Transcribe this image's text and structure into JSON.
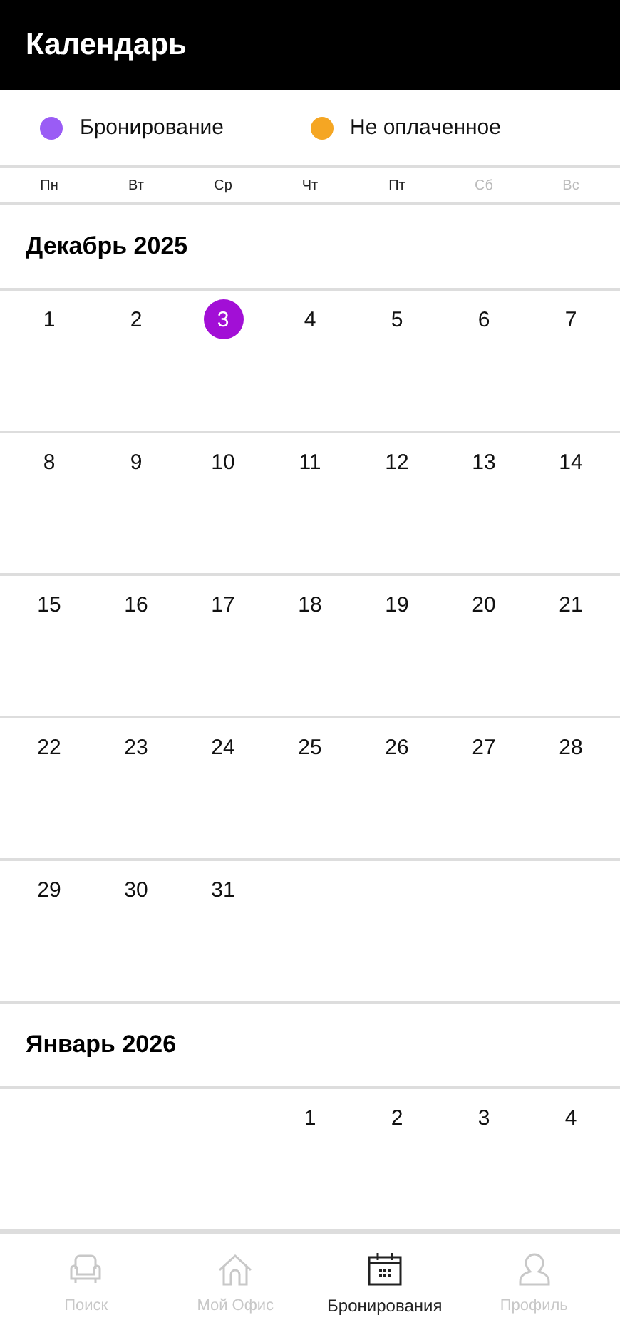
{
  "header": {
    "title": "Календарь"
  },
  "legend": [
    {
      "label": "Бронирование",
      "color": "#9a5cf5"
    },
    {
      "label": "Не оплаченное",
      "color": "#f5a623"
    }
  ],
  "weekdays": [
    {
      "label": "Пн",
      "weekend": false
    },
    {
      "label": "Вт",
      "weekend": false
    },
    {
      "label": "Ср",
      "weekend": false
    },
    {
      "label": "Чт",
      "weekend": false
    },
    {
      "label": "Пт",
      "weekend": false
    },
    {
      "label": "Сб",
      "weekend": true
    },
    {
      "label": "Вс",
      "weekend": true
    }
  ],
  "months": [
    {
      "title": "Декабрь 2025",
      "weeks": [
        [
          {
            "kind": "day",
            "day": "1",
            "selected": false
          },
          {
            "kind": "day",
            "day": "2",
            "selected": false
          },
          {
            "kind": "day",
            "day": "3",
            "selected": true
          },
          {
            "kind": "day",
            "day": "4",
            "selected": false
          },
          {
            "kind": "day",
            "day": "5",
            "selected": false
          },
          {
            "kind": "day",
            "day": "6",
            "selected": false
          },
          {
            "kind": "day",
            "day": "7",
            "selected": false
          }
        ],
        [
          {
            "kind": "day",
            "day": "8",
            "selected": false
          },
          {
            "kind": "day",
            "day": "9",
            "selected": false
          },
          {
            "kind": "day",
            "day": "10",
            "selected": false
          },
          {
            "kind": "day",
            "day": "11",
            "selected": false
          },
          {
            "kind": "day",
            "day": "12",
            "selected": false
          },
          {
            "kind": "day",
            "day": "13",
            "selected": false
          },
          {
            "kind": "day",
            "day": "14",
            "selected": false
          }
        ],
        [
          {
            "kind": "day",
            "day": "15",
            "selected": false
          },
          {
            "kind": "day",
            "day": "16",
            "selected": false
          },
          {
            "kind": "day",
            "day": "17",
            "selected": false
          },
          {
            "kind": "day",
            "day": "18",
            "selected": false
          },
          {
            "kind": "day",
            "day": "19",
            "selected": false
          },
          {
            "kind": "day",
            "day": "20",
            "selected": false
          },
          {
            "kind": "day",
            "day": "21",
            "selected": false
          }
        ],
        [
          {
            "kind": "day",
            "day": "22",
            "selected": false
          },
          {
            "kind": "day",
            "day": "23",
            "selected": false
          },
          {
            "kind": "day",
            "day": "24",
            "selected": false
          },
          {
            "kind": "day",
            "day": "25",
            "selected": false
          },
          {
            "kind": "day",
            "day": "26",
            "selected": false
          },
          {
            "kind": "day",
            "day": "27",
            "selected": false
          },
          {
            "kind": "day",
            "day": "28",
            "selected": false
          }
        ],
        [
          {
            "kind": "day",
            "day": "29",
            "selected": false
          },
          {
            "kind": "day",
            "day": "30",
            "selected": false
          },
          {
            "kind": "day",
            "day": "31",
            "selected": false
          },
          {
            "kind": "blank"
          },
          {
            "kind": "blank"
          },
          {
            "kind": "blank"
          },
          {
            "kind": "blank"
          }
        ]
      ]
    },
    {
      "title": "Январь 2026",
      "weeks": [
        [
          {
            "kind": "blank"
          },
          {
            "kind": "blank"
          },
          {
            "kind": "blank"
          },
          {
            "kind": "day",
            "day": "1",
            "selected": false
          },
          {
            "kind": "day",
            "day": "2",
            "selected": false
          },
          {
            "kind": "day",
            "day": "3",
            "selected": false
          },
          {
            "kind": "day",
            "day": "4",
            "selected": false
          }
        ]
      ]
    }
  ],
  "nav": [
    {
      "label": "Поиск",
      "selected": false
    },
    {
      "label": "Мой Офис",
      "selected": false
    },
    {
      "label": "Бронирования",
      "selected": true
    },
    {
      "label": "Профиль",
      "selected": false
    }
  ]
}
